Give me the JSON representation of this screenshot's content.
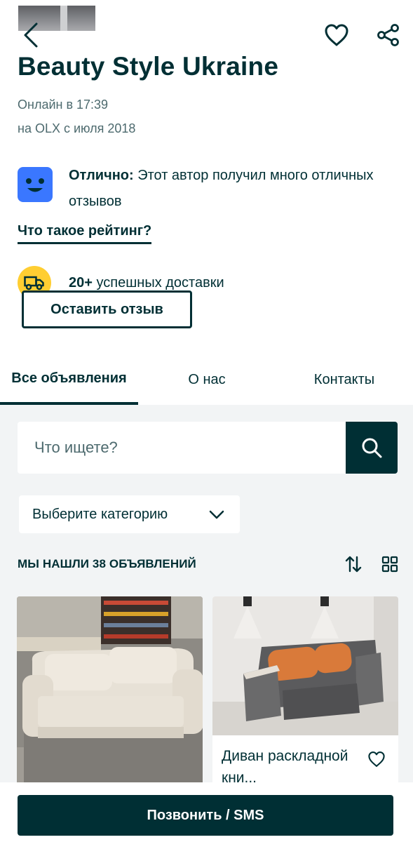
{
  "header": {
    "seller_name": "Beauty Style Ukraine",
    "online_status": "Онлайн в 17:39",
    "member_since": "на OLX с июля 2018"
  },
  "rating": {
    "label": "Отлично:",
    "text": " Этот автор получил много отличных отзывов",
    "link": "Что такое рейтинг?"
  },
  "delivery": {
    "count": "20+",
    "text": " успешных доставки"
  },
  "review_button": "Оставить отзыв",
  "tabs": [
    {
      "label": "Все объявления",
      "active": true
    },
    {
      "label": "О нас",
      "active": false
    },
    {
      "label": "Контакты",
      "active": false
    }
  ],
  "search": {
    "placeholder": "Что ищете?"
  },
  "category": {
    "label": "Выберите категорию"
  },
  "results": {
    "count_text": "Мы нашли 38 объявлений"
  },
  "listings": [
    {
      "title": "",
      "image": "beige-sofa-photo"
    },
    {
      "title": "Диван раскладной кни...",
      "image": "gray-sofa-photo"
    }
  ],
  "cta": {
    "call_label": "Позвонить / SMS"
  },
  "colors": {
    "primary": "#002f34",
    "muted_text": "#4d6a6e",
    "background_gray": "#f2f4f5",
    "rating_blue": "#3a77ff",
    "delivery_yellow": "#ffce32"
  },
  "icons": [
    "back-arrow-icon",
    "heart-icon",
    "share-icon",
    "smiley-icon",
    "delivery-truck-icon",
    "search-icon",
    "chevron-down-icon",
    "sort-icon",
    "grid-view-icon"
  ]
}
